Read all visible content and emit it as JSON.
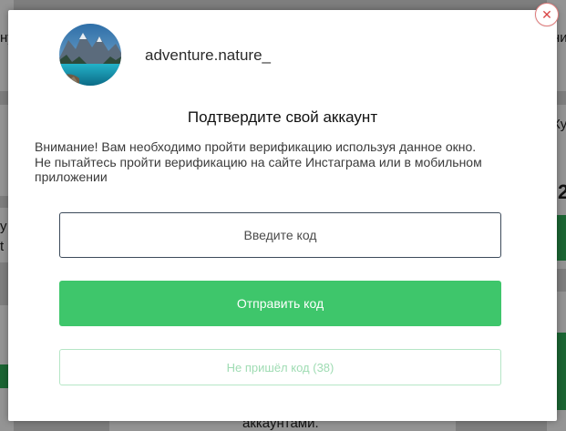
{
  "background": {
    "fragments": [
      "ну",
      "ни",
      "у",
      "t",
      "Ку",
      "2",
      "аккаунтами."
    ]
  },
  "modal": {
    "username": "adventure.nature_",
    "title": "Подтвердите свой аккаунт",
    "warning_line1": "Внимание! Вам необходимо пройти верификацию используя данное окно.",
    "warning_line2": "Не пытайтесь пройти верификацию на сайте Инстаграма или в мобильном приложении",
    "code_placeholder": "Введите код",
    "send_label": "Отправить код",
    "resend_label": "Не пришёл код (38)",
    "close_glyph": "✕"
  },
  "colors": {
    "accent_green": "#3ec66b",
    "resend_border": "#b5e6c6",
    "close_red": "#d94646"
  },
  "icons": {
    "close": "close-icon",
    "avatar": "avatar-image"
  }
}
